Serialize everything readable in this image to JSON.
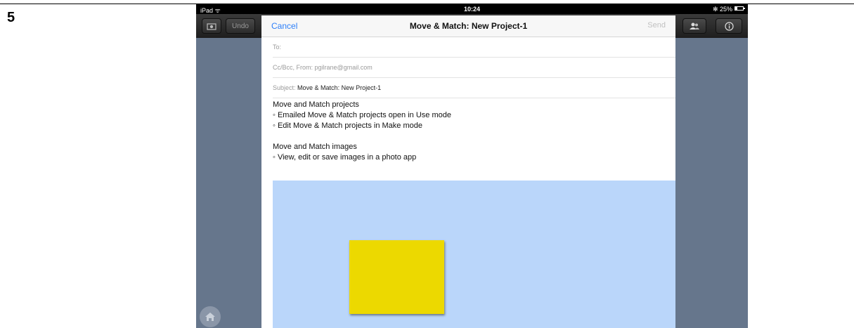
{
  "document": {
    "step_number": "5"
  },
  "statusbar": {
    "carrier": "iPad",
    "wifi_glyph": "ᯤ",
    "time": "10:24",
    "battery_text": "✻ 25%"
  },
  "appbar": {
    "undo_label": "Undo"
  },
  "compose": {
    "cancel_label": "Cancel",
    "title": "Move & Match: New Project-1",
    "send_label": "Send",
    "to_label": "To:",
    "ccbcc_from_label": "Cc/Bcc, From:",
    "from_value": "pgilrane@gmail.com",
    "subject_label": "Subject:",
    "subject_value": "Move & Match: New Project-1",
    "body": {
      "projects_heading": "Move and Match projects",
      "projects_line1": "◦ Emailed Move & Match projects open in Use mode",
      "projects_line2": "◦ Edit Move & Match projects in Make mode",
      "images_heading": "Move and Match images",
      "images_line1": "◦ View, edit or save images in a photo app"
    },
    "attachment": {
      "background_color": "#bad6fa",
      "shape_color": "#ecd900"
    }
  },
  "colors": {
    "ipad_background": "#66768c",
    "accent": "#2d7ff9"
  }
}
